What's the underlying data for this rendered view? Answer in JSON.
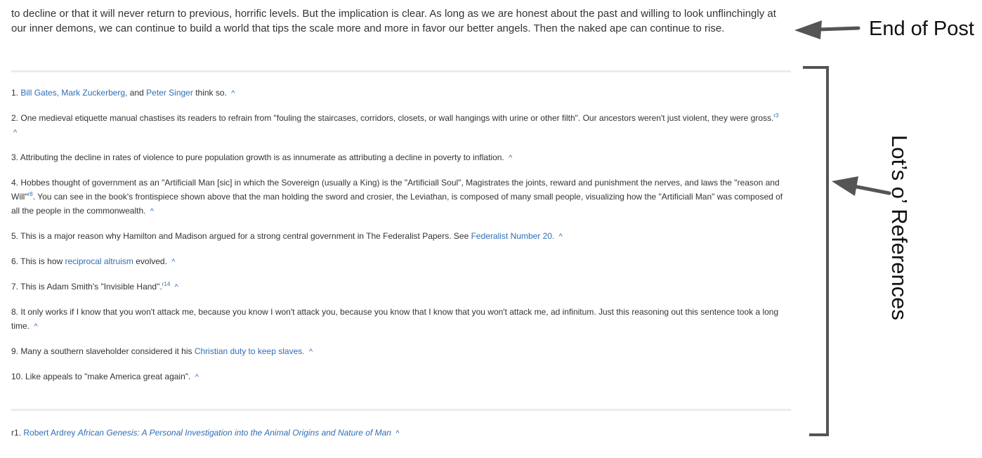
{
  "post_end": {
    "text": "to decline or that it will never return to previous, horrific levels. But the implication is clear. As long as we are honest about the past and willing to look unflinchingly at our inner demons, we can continue to build a world that tips the scale more and more in favor our better angels. Then the naked ape can continue to rise."
  },
  "annotations": {
    "end_label": "End of Post",
    "refs_label": "Lot’s o’ References",
    "color": "#555555"
  },
  "footnotes": {
    "caret": "^",
    "n1": {
      "num": "1.",
      "link1": "Bill Gates,",
      "link2": "Mark Zuckerberg,",
      "mid": "and",
      "link3": "Peter Singer",
      "tail": "think so."
    },
    "n2": {
      "num": "2.",
      "text": "One medieval etiquette manual chastises its readers to refrain from \"fouling the staircases, corridors, closets, or wall hangings with urine or other filth\". Our ancestors weren't just violent, they were gross.",
      "sup": "r3"
    },
    "n3": {
      "num": "3.",
      "text": "Attributing the decline in rates of violence to pure population growth is as innumerate as attributing a decline in poverty to inflation."
    },
    "n4": {
      "num": "4.",
      "text_a": "Hobbes thought of government as an \"Artificiall Man [sic] in which the Sovereign (usually a King) is the \"Artificiall Soul\", Magistrates the joints, reward and punishment the nerves, and laws the \"reason and Will\"",
      "sup": "r8",
      "text_b": ". You can see in the book's frontispiece shown above that the man holding the sword and crosier, the Leviathan, is composed of many small people, visualizing how the \"Artificiall Man\" was composed of all the people in the commonwealth."
    },
    "n5": {
      "num": "5.",
      "text": "This is a major reason why Hamilton and Madison argued for a strong central government in The Federalist Papers. See",
      "link": "Federalist Number 20."
    },
    "n6": {
      "num": "6.",
      "text": "This is how",
      "link": "reciprocal altruism",
      "tail": "evolved."
    },
    "n7": {
      "num": "7.",
      "text": "This is Adam Smith's \"Invisible Hand\".",
      "sup": "r14"
    },
    "n8": {
      "num": "8.",
      "text": "It only works if I know that you won't attack me, because you know I won't attack you, because you know that I know that you won't attack me, ad infinitum. Just this reasoning out this sentence took a long time."
    },
    "n9": {
      "num": "9.",
      "text": "Many a southern slaveholder considered it his",
      "link": "Christian duty to keep slaves."
    },
    "n10": {
      "num": "10.",
      "text": "Like appeals to \"make America great again\"."
    }
  },
  "references": {
    "r1": {
      "num": "r1.",
      "author": "Robert Ardrey",
      "title": "African Genesis: A Personal Investigation into the Animal Origins and Nature of Man"
    }
  }
}
